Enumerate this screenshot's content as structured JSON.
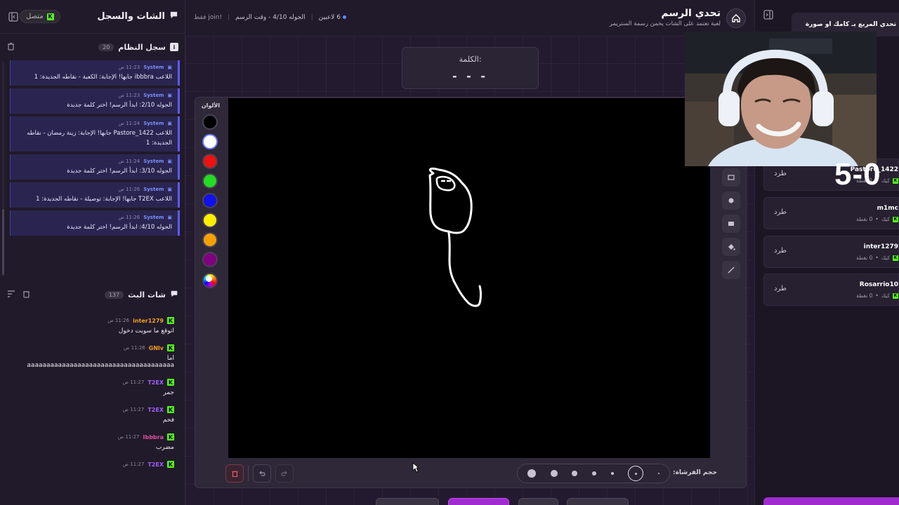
{
  "left_panel": {
    "title": "الشات والسجل",
    "status": "متصل",
    "log_section": {
      "title": "سجل النظام",
      "count": "20"
    },
    "log_items": [
      {
        "sender": "System",
        "time": "11:23 ص",
        "message": "اللاعب ibbbra جابها! الإجابة: الكعبة - نقاطه الجديدة: 1"
      },
      {
        "sender": "System",
        "time": "11:23 ص",
        "message": "الجوله 2/10: ابدأ الرسم! اختر كلمة جديدة"
      },
      {
        "sender": "System",
        "time": "11:24 ص",
        "message": "اللاعب Pastore_1422 جابها! الإجابة: زينة رمضان - نقاطه الجديدة: 1"
      },
      {
        "sender": "System",
        "time": "11:24 ص",
        "message": "الجوله 3/10: ابدأ الرسم! اختر كلمة جديدة"
      },
      {
        "sender": "System",
        "time": "11:26 ص",
        "message": "اللاعب T2EX جابها! الإجابة: توصيلة - نقاطه الجديدة: 1"
      },
      {
        "sender": "System",
        "time": "11:26 ص",
        "message": "الجوله 4/10: ابدأ الرسم! اختر كلمة جديدة"
      }
    ],
    "chat_section": {
      "title": "شات البث",
      "count": "137"
    },
    "chat_messages": [
      {
        "user": "inter1279",
        "color": "#f0a020",
        "time": "11:26 ص",
        "text": "اتوقع ما سويت دخول"
      },
      {
        "user": "GNlv",
        "color": "#f0a020",
        "time": "11:26 ص",
        "text": "اما\naaaaaaaaaaaaaaaaaaaaaaaaaaaaaaaaaaaaaa"
      },
      {
        "user": "T2EX",
        "color": "#a060ff",
        "time": "11:27 ص",
        "text": "جمر"
      },
      {
        "user": "T2EX",
        "color": "#a060ff",
        "time": "11:27 ص",
        "text": "فحم"
      },
      {
        "user": "Ibbbra",
        "color": "#e050a0",
        "time": "11:27 ص",
        "text": "مضرب"
      },
      {
        "user": "T2EX",
        "color": "#a060ff",
        "time": "11:27 ص",
        "text": ""
      }
    ]
  },
  "topbar": {
    "title": "تحدي الرسم",
    "subtitle": "لعبة تعتمد على الشات يخمن رسمة الستريمر",
    "players": "6 لاعبين",
    "round": "الجوله 4/10 - وقت الرسم",
    "join_hint": "!join فقط"
  },
  "word_box": {
    "label": "الكلمة:",
    "value": "- - -"
  },
  "palette": {
    "label": "الألوان",
    "colors": [
      "#000000",
      "#ffffff",
      "#ee1111",
      "#22dd22",
      "#1111ee",
      "#ffee00",
      "#f5a000",
      "#800080"
    ]
  },
  "brush": {
    "label": "حجم الفرشاة:"
  },
  "right_panel": {
    "challenge": "تحدي المربع بـ كامك او صورة",
    "score_overlay": "5-0",
    "kick_label": "طرد",
    "players": [
      {
        "name": "Pastore_1422",
        "points": "1 نقطة",
        "platform": "كيك"
      },
      {
        "name": "m1mc",
        "points": "0 نقطة",
        "platform": "كيك"
      },
      {
        "name": "inter1279",
        "points": "0 نقطة",
        "platform": "كيك"
      },
      {
        "name": "Rosarrio10",
        "points": "0 نقطة",
        "platform": "كيك"
      }
    ]
  }
}
